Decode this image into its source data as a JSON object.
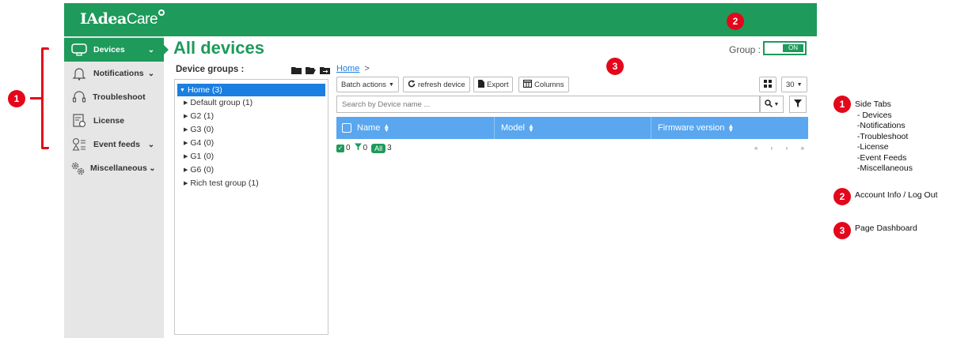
{
  "header": {
    "logo_brand": "IAdea",
    "logo_product": "Care"
  },
  "sidebar": {
    "items": [
      {
        "label": "Devices",
        "icon": "devices-icon",
        "has_chevron": true,
        "active": true
      },
      {
        "label": "Notifications",
        "icon": "bell-icon",
        "has_chevron": true
      },
      {
        "label": "Troubleshoot",
        "icon": "headset-icon",
        "has_chevron": false
      },
      {
        "label": "License",
        "icon": "license-icon",
        "has_chevron": false
      },
      {
        "label": "Event feeds",
        "icon": "event-feeds-icon",
        "has_chevron": true
      },
      {
        "label": "Miscellaneous",
        "icon": "gears-icon",
        "has_chevron": true
      }
    ],
    "chevron": "⌄"
  },
  "main": {
    "title": "All devices",
    "group_label": "Group :",
    "group_toggle": "ON",
    "device_groups_label": "Device groups :",
    "tree": [
      {
        "label": "Home (3)",
        "expanded": true,
        "selected": true
      },
      {
        "label": "Default group (1)"
      },
      {
        "label": "G2 (1)"
      },
      {
        "label": "G3 (0)"
      },
      {
        "label": "G4 (0)"
      },
      {
        "label": "G1 (0)"
      },
      {
        "label": "G6 (0)"
      },
      {
        "label": "Rich test group (1)"
      }
    ],
    "breadcrumb": {
      "home": "Home",
      "separator": ">"
    },
    "toolbar": {
      "batch_actions": "Batch actions",
      "refresh_device": "refresh device",
      "export": "Export",
      "columns": "Columns",
      "page_size": "30"
    },
    "search_placeholder": "Search by Device name ...",
    "table": {
      "columns": [
        "Name",
        "Model",
        "Firmware version"
      ]
    },
    "summary": {
      "checked": "0",
      "filtered": "0",
      "all_label": "All",
      "total": "3"
    },
    "pager": "« ‹ › »"
  },
  "annotations": {
    "markers": [
      "1",
      "2",
      "3",
      "1",
      "2",
      "3"
    ],
    "legend": [
      {
        "number": "1",
        "text": "Side Tabs\n - Devices\n -Notifications\n -Troubleshoot\n -License\n -Event Feeds\n -Miscellaneous"
      },
      {
        "number": "2",
        "text": "Account Info / Log Out"
      },
      {
        "number": "3",
        "text": "Page Dashboard"
      }
    ]
  },
  "colors": {
    "brand_green": "#1e9a5b",
    "selection_blue": "#1a7fe0",
    "table_header": "#5aa7ef",
    "annotation_red": "#e4071b",
    "sidebar_bg": "#e6e6e6"
  }
}
